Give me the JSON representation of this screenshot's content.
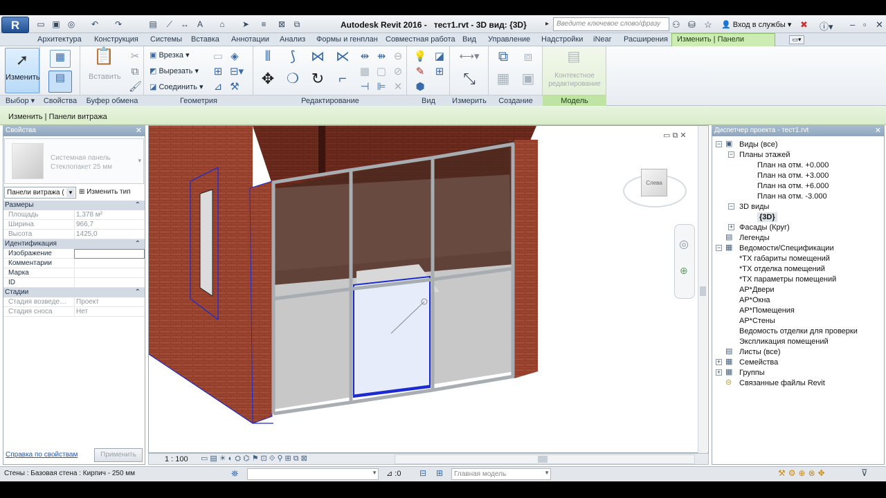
{
  "app": {
    "title": "Autodesk Revit 2016 -",
    "file_view": "тест1.rvt - 3D вид: {3D}",
    "search_placeholder": "Введите ключевое слово/фразу",
    "login": "Вход в службы",
    "app_button": "R"
  },
  "tabs": [
    "Архитектура",
    "Конструкция",
    "Системы",
    "Вставка",
    "Аннотации",
    "Анализ",
    "Формы и генплан",
    "Совместная работа",
    "Вид",
    "Управление",
    "Надстройки",
    "iNear",
    "Расширения"
  ],
  "context_tab": "Изменить | Панели витража",
  "ribbon": {
    "panels": [
      "Выбор",
      "Свойства",
      "Буфер обмена",
      "Геометрия",
      "Редактирование",
      "Вид",
      "Измерить",
      "Создание",
      "Модель"
    ],
    "modify_label": "Изменить",
    "paste_label": "Вставить",
    "geometry": {
      "cope": "Врезка",
      "cut": "Вырезать",
      "join": "Соединить"
    },
    "model": {
      "line1": "Контекстное",
      "line2": "редактирование"
    }
  },
  "optionbar": {
    "text": "Изменить | Панели витража"
  },
  "properties": {
    "title": "Свойства",
    "type_line1": "Системная панель",
    "type_line2": "Стеклопакет 25 мм",
    "filter": "Панели витража (",
    "edit_type": "Изменить тип",
    "sections": [
      {
        "name": "Размеры",
        "rows": [
          {
            "k": "Площадь",
            "v": "1,378 м²"
          },
          {
            "k": "Ширина",
            "v": "966,7"
          },
          {
            "k": "Высота",
            "v": "1425,0"
          }
        ]
      },
      {
        "name": "Идентификация",
        "rows": [
          {
            "k": "Изображение",
            "v": ""
          },
          {
            "k": "Комментарии",
            "v": ""
          },
          {
            "k": "Марка",
            "v": ""
          },
          {
            "k": "ID",
            "v": ""
          }
        ]
      },
      {
        "name": "Стадии",
        "rows": [
          {
            "k": "Стадия возведе…",
            "v": "Проект"
          },
          {
            "k": "Стадия сноса",
            "v": "Нет"
          }
        ]
      }
    ],
    "help_link": "Справка по свойствам",
    "apply": "Применить"
  },
  "viewport": {
    "scale": "1 : 100",
    "viewcube_label": "Слева"
  },
  "browser": {
    "title": "Диспетчер проекта - тест1.rvt",
    "tree": [
      {
        "label": "Виды (все)",
        "level": 0,
        "exp": "−"
      },
      {
        "label": "Планы этажей",
        "level": 1,
        "exp": "−"
      },
      {
        "label": "План на отм. +0.000",
        "level": 2
      },
      {
        "label": "План на отм. +3.000",
        "level": 2
      },
      {
        "label": "План на отм. +6.000",
        "level": 2
      },
      {
        "label": "План на отм. -3.000",
        "level": 2
      },
      {
        "label": "3D виды",
        "level": 1,
        "exp": "−"
      },
      {
        "label": "{3D}",
        "level": 2,
        "bold": true
      },
      {
        "label": "Фасады (Круг)",
        "level": 1,
        "exp": "+"
      },
      {
        "label": "Легенды",
        "level": 0
      },
      {
        "label": "Ведомости/Спецификации",
        "level": 0,
        "exp": "−"
      },
      {
        "label": "*ТХ габариты помещений",
        "level": 1
      },
      {
        "label": "*ТХ отделка помещений",
        "level": 1
      },
      {
        "label": "*ТХ параметры помещений",
        "level": 1
      },
      {
        "label": "АР*Двери",
        "level": 1
      },
      {
        "label": "АР*Окна",
        "level": 1
      },
      {
        "label": "АР*Помещения",
        "level": 1
      },
      {
        "label": "АР*Стены",
        "level": 1
      },
      {
        "label": "Ведомость отделки для проверки",
        "level": 1
      },
      {
        "label": "Экспликация помещений",
        "level": 1
      },
      {
        "label": "Листы (все)",
        "level": 0
      },
      {
        "label": "Семейства",
        "level": 0,
        "exp": "+"
      },
      {
        "label": "Группы",
        "level": 0,
        "exp": "+"
      },
      {
        "label": "Связанные файлы Revit",
        "level": 0
      }
    ]
  },
  "status": {
    "text": "Стены : Базовая стена : Кирпич - 250 мм",
    "count": ":0",
    "model": "Главная модель"
  }
}
